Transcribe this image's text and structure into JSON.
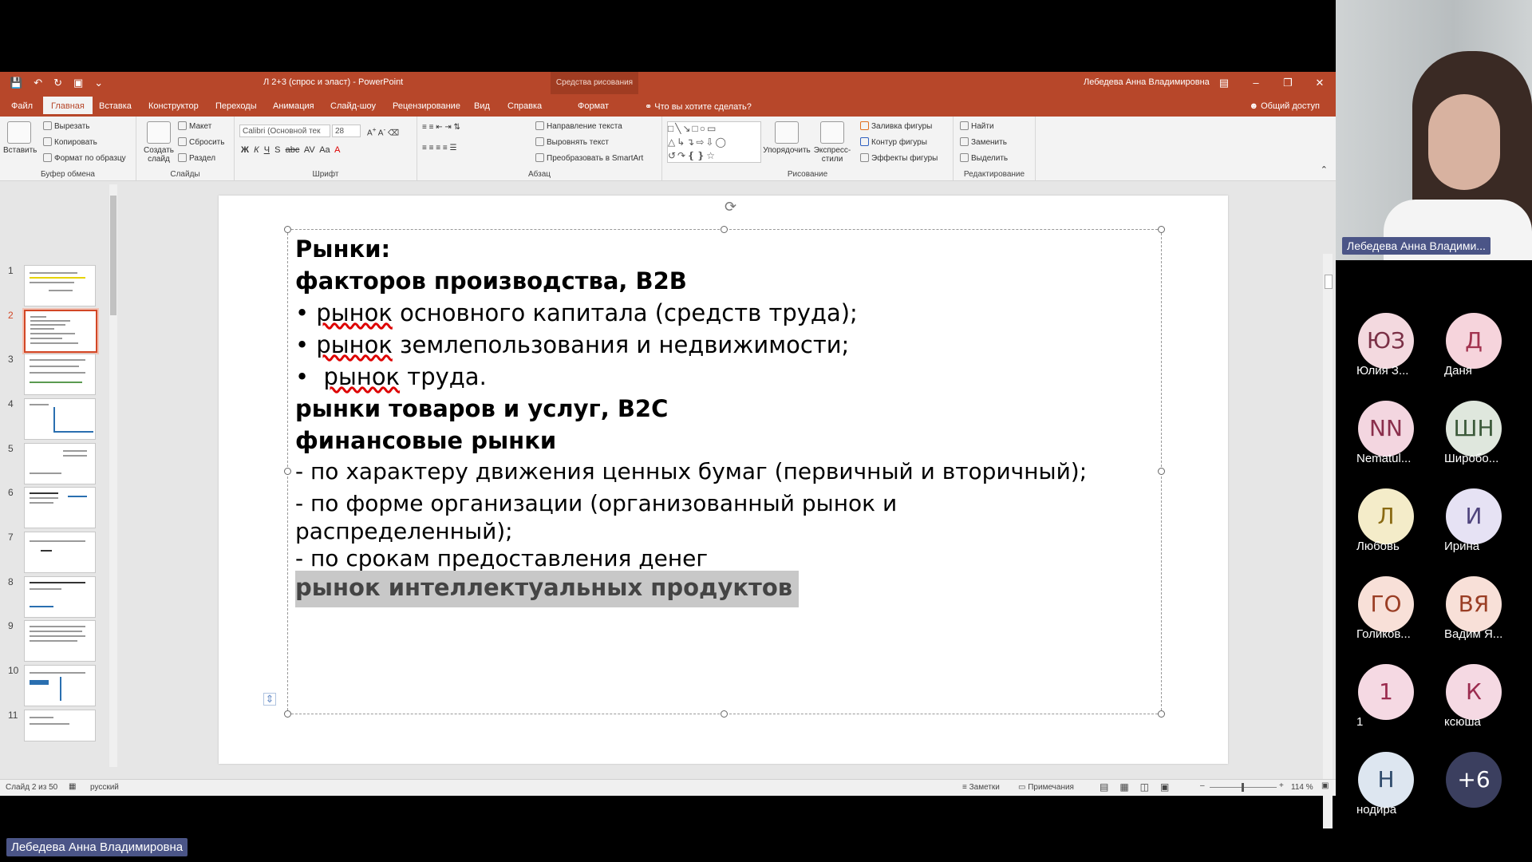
{
  "powerpoint": {
    "doc_title": "Л 2+3 (спрос и эласт) - PowerPoint",
    "context_tab": "Средства рисования",
    "user_name": "Лебедева Анна Владимировна",
    "tabs": [
      "Файл",
      "Главная",
      "Вставка",
      "Конструктор",
      "Переходы",
      "Анимация",
      "Слайд-шоу",
      "Рецензирование",
      "Вид",
      "Справка",
      "Формат"
    ],
    "tell_me": "Что вы хотите сделать?",
    "share": "Общий доступ",
    "ribbon": {
      "paste": "Вставить",
      "cut": "Вырезать",
      "copy": "Копировать",
      "format_painter": "Формат по образцу",
      "clipboard_group": "Буфер обмена",
      "new_slide": "Создать слайд",
      "layout": "Макет",
      "reset": "Сбросить",
      "section": "Раздел",
      "slides_group": "Слайды",
      "font_name": "Calibri (Основной тек",
      "font_size": "28",
      "font_group": "Шрифт",
      "text_direction": "Направление текста",
      "align_text": "Выровнять текст",
      "convert_smartart": "Преобразовать в SmartArt",
      "paragraph_group": "Абзац",
      "arrange": "Упорядочить",
      "quick_styles": "Экспресс-стили",
      "shape_fill": "Заливка фигуры",
      "shape_outline": "Контур фигуры",
      "shape_effects": "Эффекты фигуры",
      "drawing_group": "Рисование",
      "find": "Найти",
      "replace": "Заменить",
      "select": "Выделить",
      "editing_group": "Редактирование"
    },
    "slide_numbers": [
      "1",
      "2",
      "3",
      "4",
      "5",
      "6",
      "7",
      "8",
      "9",
      "10",
      "11"
    ],
    "selected_slide": 2,
    "slide": {
      "lines": [
        "Рынки:",
        "факторов производства, В2В",
        "рынок",
        " основного капитала (средств труда);",
        "рынок",
        " землепользования и недвижимости;",
        "рынок",
        " труда.",
        "рынки товаров и услуг, В2С",
        "финансовые рынки",
        "- по характеру движения ценных бумаг (первичный и вторичный);",
        "- по форме организации (организованный рынок и",
        "распределенный);",
        "- по срокам предоставления денег",
        "рынок интеллектуальных продуктов"
      ]
    },
    "status": {
      "slide_of": "Слайд 2 из 50",
      "language": "русский",
      "notes": "Заметки",
      "comments": "Примечания",
      "zoom": "114 %"
    }
  },
  "video_call": {
    "speaker_name": "Лебедева Анна Владими...",
    "presenter_label": "Лебедева Анна Владимировна",
    "participants": [
      {
        "initials": "ЮЗ",
        "name": "Юлия З...",
        "bg": "#f3d9df",
        "fg": "#7a3046"
      },
      {
        "initials": "Д",
        "name": "Даня",
        "bg": "#f6d4dc",
        "fg": "#a2334f"
      },
      {
        "initials": "NN",
        "name": "Nematul...",
        "bg": "#f3d6e0",
        "fg": "#8a2f4c"
      },
      {
        "initials": "ШН",
        "name": "Широбо...",
        "bg": "#dfe7dd",
        "fg": "#3c5a3a"
      },
      {
        "initials": "Л",
        "name": "Любовь",
        "bg": "#f4ecc9",
        "fg": "#8a6a12"
      },
      {
        "initials": "И",
        "name": "Ирина",
        "bg": "#e6e2f4",
        "fg": "#4f447d"
      },
      {
        "initials": "ГО",
        "name": "Голиков...",
        "bg": "#f8e0d8",
        "fg": "#9a3e25"
      },
      {
        "initials": "ВЯ",
        "name": "Вадим Я...",
        "bg": "#f8e0d8",
        "fg": "#9a3e25"
      },
      {
        "initials": "1",
        "name": "1",
        "bg": "#f5d9e3",
        "fg": "#9b2c4f"
      },
      {
        "initials": "К",
        "name": "ксюша",
        "bg": "#f5d9e3",
        "fg": "#9b2c4f"
      },
      {
        "initials": "Н",
        "name": "нодира",
        "bg": "#dde6f0",
        "fg": "#2f4b6c"
      },
      {
        "initials": "+6",
        "name": "",
        "bg": "#3b3f5f",
        "fg": "#ffffff"
      }
    ]
  }
}
